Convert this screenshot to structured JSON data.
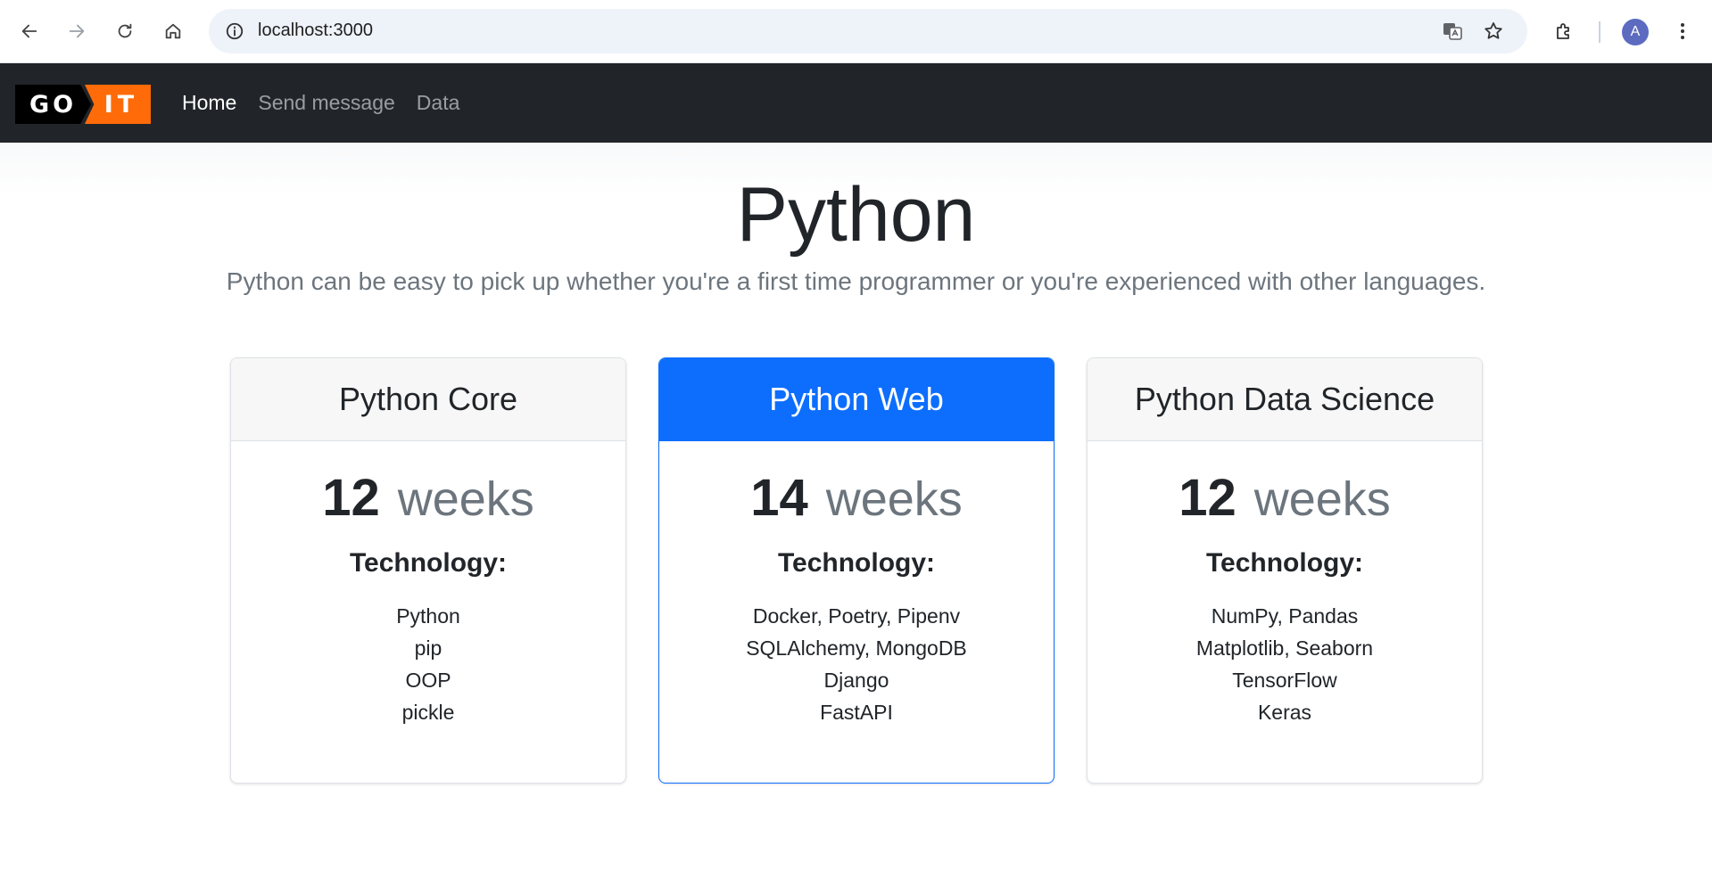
{
  "browser": {
    "url": "localhost:3000",
    "profile_initial": "A"
  },
  "navbar": {
    "logo": {
      "left": "GO",
      "right": "IT"
    },
    "links": [
      {
        "label": "Home",
        "active": true
      },
      {
        "label": "Send message",
        "active": false
      },
      {
        "label": "Data",
        "active": false
      }
    ]
  },
  "hero": {
    "title": "Python",
    "subtitle": "Python can be easy to pick up whether you're a first time programmer or you're experienced with other languages."
  },
  "cards": [
    {
      "title": "Python Core",
      "weeks": "12",
      "unit": "weeks",
      "tech_title": "Technology:",
      "items": [
        "Python",
        "pip",
        "OOP",
        "pickle"
      ],
      "highlighted": false
    },
    {
      "title": "Python Web",
      "weeks": "14",
      "unit": "weeks",
      "tech_title": "Technology:",
      "items": [
        "Docker, Poetry, Pipenv",
        "SQLAlchemy, MongoDB",
        "Django",
        "FastAPI"
      ],
      "highlighted": true
    },
    {
      "title": "Python Data Science",
      "weeks": "12",
      "unit": "weeks",
      "tech_title": "Technology:",
      "items": [
        "NumPy, Pandas",
        "Matplotlib, Seaborn",
        "TensorFlow",
        "Keras"
      ],
      "highlighted": false
    }
  ],
  "colors": {
    "navbar_bg": "#212529",
    "primary": "#0d6efd",
    "logo_orange": "#ff6b08"
  }
}
